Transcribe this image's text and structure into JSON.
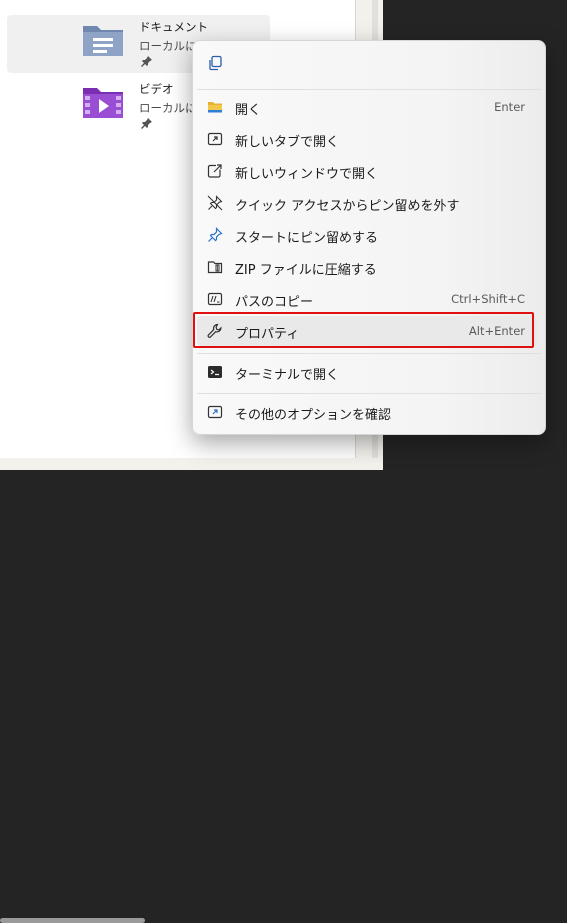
{
  "folders": [
    {
      "name": "ドキュメント",
      "subtitle": "ローカルに保",
      "icon": "documents-folder-icon"
    },
    {
      "name": "ビデオ",
      "subtitle": "ローカルに保",
      "icon": "videos-folder-icon"
    }
  ],
  "menu": {
    "top_icon": "copy-icon",
    "items": [
      {
        "label": "開く",
        "shortcut": "Enter",
        "icon": "folder-open-icon"
      },
      {
        "label": "新しいタブで開く",
        "shortcut": "",
        "icon": "new-tab-icon"
      },
      {
        "label": "新しいウィンドウで開く",
        "shortcut": "",
        "icon": "new-window-icon"
      },
      {
        "label": "クイック アクセスからピン留めを外す",
        "shortcut": "",
        "icon": "unpin-icon"
      },
      {
        "label": "スタートにピン留めする",
        "shortcut": "",
        "icon": "pin-icon"
      },
      {
        "label": "ZIP ファイルに圧縮する",
        "shortcut": "",
        "icon": "zip-icon"
      },
      {
        "label": "パスのコピー",
        "shortcut": "Ctrl+Shift+C",
        "icon": "copy-path-icon"
      },
      {
        "label": "プロパティ",
        "shortcut": "Alt+Enter",
        "icon": "wrench-icon"
      },
      {
        "label": "ターミナルで開く",
        "shortcut": "",
        "icon": "terminal-icon"
      },
      {
        "label": "その他のオプションを確認",
        "shortcut": "",
        "icon": "more-options-icon"
      }
    ]
  },
  "colors": {
    "highlight_border": "#e01010",
    "folder_accent": "#6a7fa8",
    "video_accent": "#8a3fc4"
  }
}
